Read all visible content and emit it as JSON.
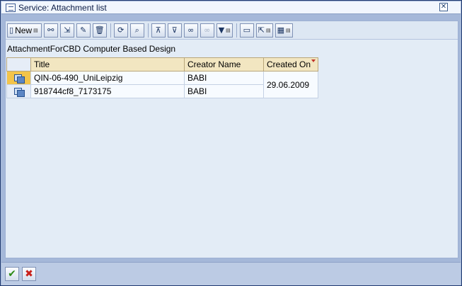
{
  "window": {
    "title": "Service: Attachment list"
  },
  "toolbar": {
    "new_label": "New",
    "buttons": [
      {
        "icon": "new-icon"
      },
      {
        "icon": "glasses-display-icon"
      },
      {
        "icon": "import-icon"
      },
      {
        "icon": "pencil-edit-icon"
      },
      {
        "icon": "trash-delete-icon"
      },
      {
        "icon": "refresh-icon"
      },
      {
        "icon": "details-magnifier-icon"
      },
      {
        "icon": "sort-ascending-icon"
      },
      {
        "icon": "sort-descending-icon"
      },
      {
        "icon": "binoculars-find-icon"
      },
      {
        "icon": "find-next-icon"
      },
      {
        "icon": "filter-icon"
      },
      {
        "icon": "print-preview-icon"
      },
      {
        "icon": "export-icon"
      },
      {
        "icon": "layout-icon"
      }
    ]
  },
  "heading": "AttachmentForCBD Computer Based Design",
  "table": {
    "columns": [
      "Title",
      "Creator Name",
      "Created On"
    ],
    "rows": [
      {
        "title": "QIN-06-490_UniLeipzig",
        "creator": "BABI",
        "created": "29.06.2009"
      },
      {
        "title": "918744cf8_7173175",
        "creator": "BABI",
        "created": ""
      }
    ]
  },
  "footer": {
    "ok_icon": "checkmark-icon",
    "cancel_icon": "cancel-x-icon"
  },
  "colors": {
    "header_bg": "#f2e6c1",
    "selected_row": "#f3c44a",
    "frame": "#a5b8d9"
  }
}
